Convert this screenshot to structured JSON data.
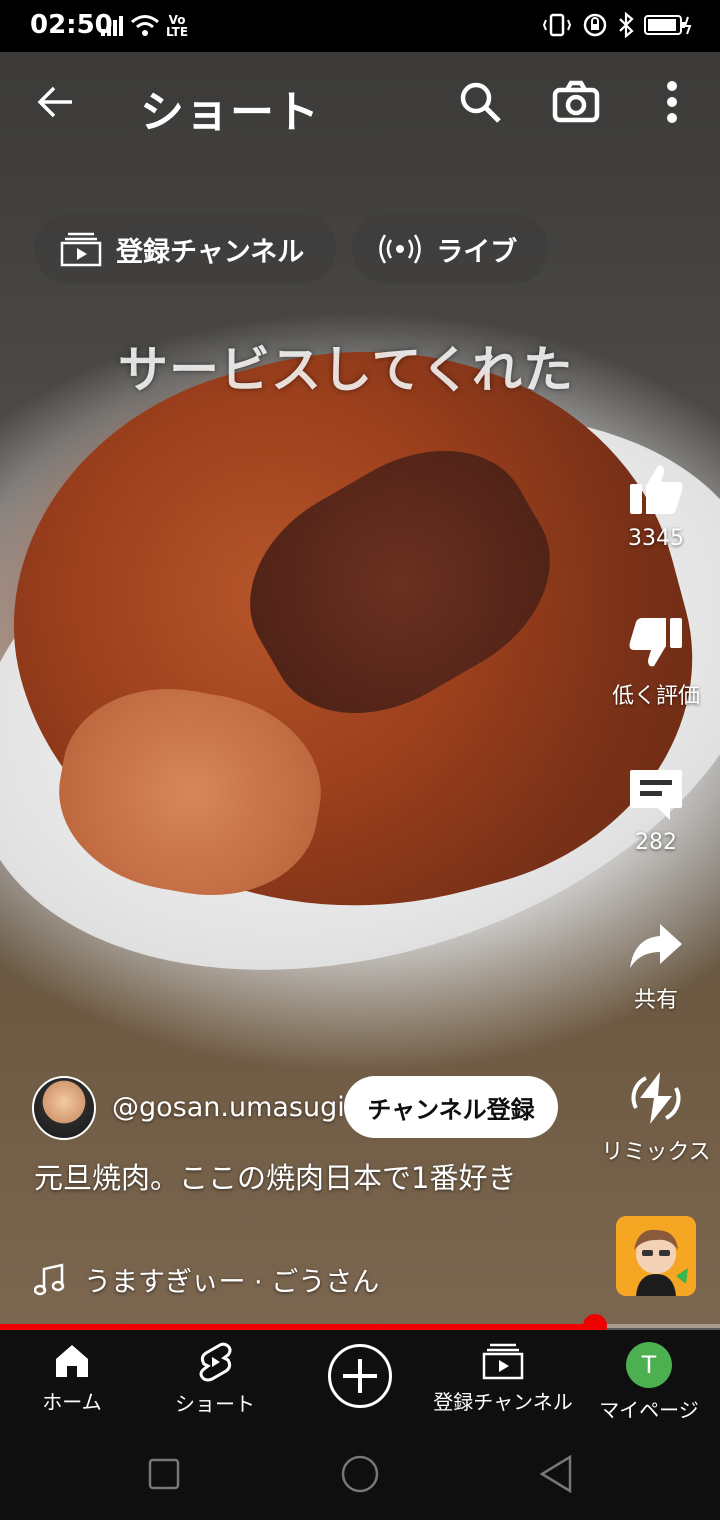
{
  "status_bar": {
    "time": "02:50",
    "volte_line1": "Vo",
    "volte_line2": "LTE"
  },
  "top_bar": {
    "title": "ショート"
  },
  "chips": [
    {
      "label": "登録チャンネル",
      "icon": "subscriptions-icon"
    },
    {
      "label": "ライブ",
      "icon": "live-icon"
    }
  ],
  "video": {
    "overlay_text": "サービスしてくれた"
  },
  "actions": {
    "like_count": "3345",
    "dislike_label": "低く評価",
    "comment_count": "282",
    "share_label": "共有",
    "remix_label": "リミックス"
  },
  "channel": {
    "handle": "@gosan.umasugi",
    "subscribe_label": "チャンネル登録"
  },
  "caption": "元旦焼肉。ここの焼肉日本で1番好き",
  "music": {
    "title": "うますぎぃー · ごうさん"
  },
  "progress": {
    "fraction": 0.826
  },
  "bottom_nav": {
    "home": "ホーム",
    "shorts": "ショート",
    "subscriptions": "登録チャンネル",
    "mypage": "マイページ",
    "avatar_letter": "T"
  },
  "colors": {
    "progress": "#ee0000",
    "avatar_bg": "#4caf50"
  }
}
